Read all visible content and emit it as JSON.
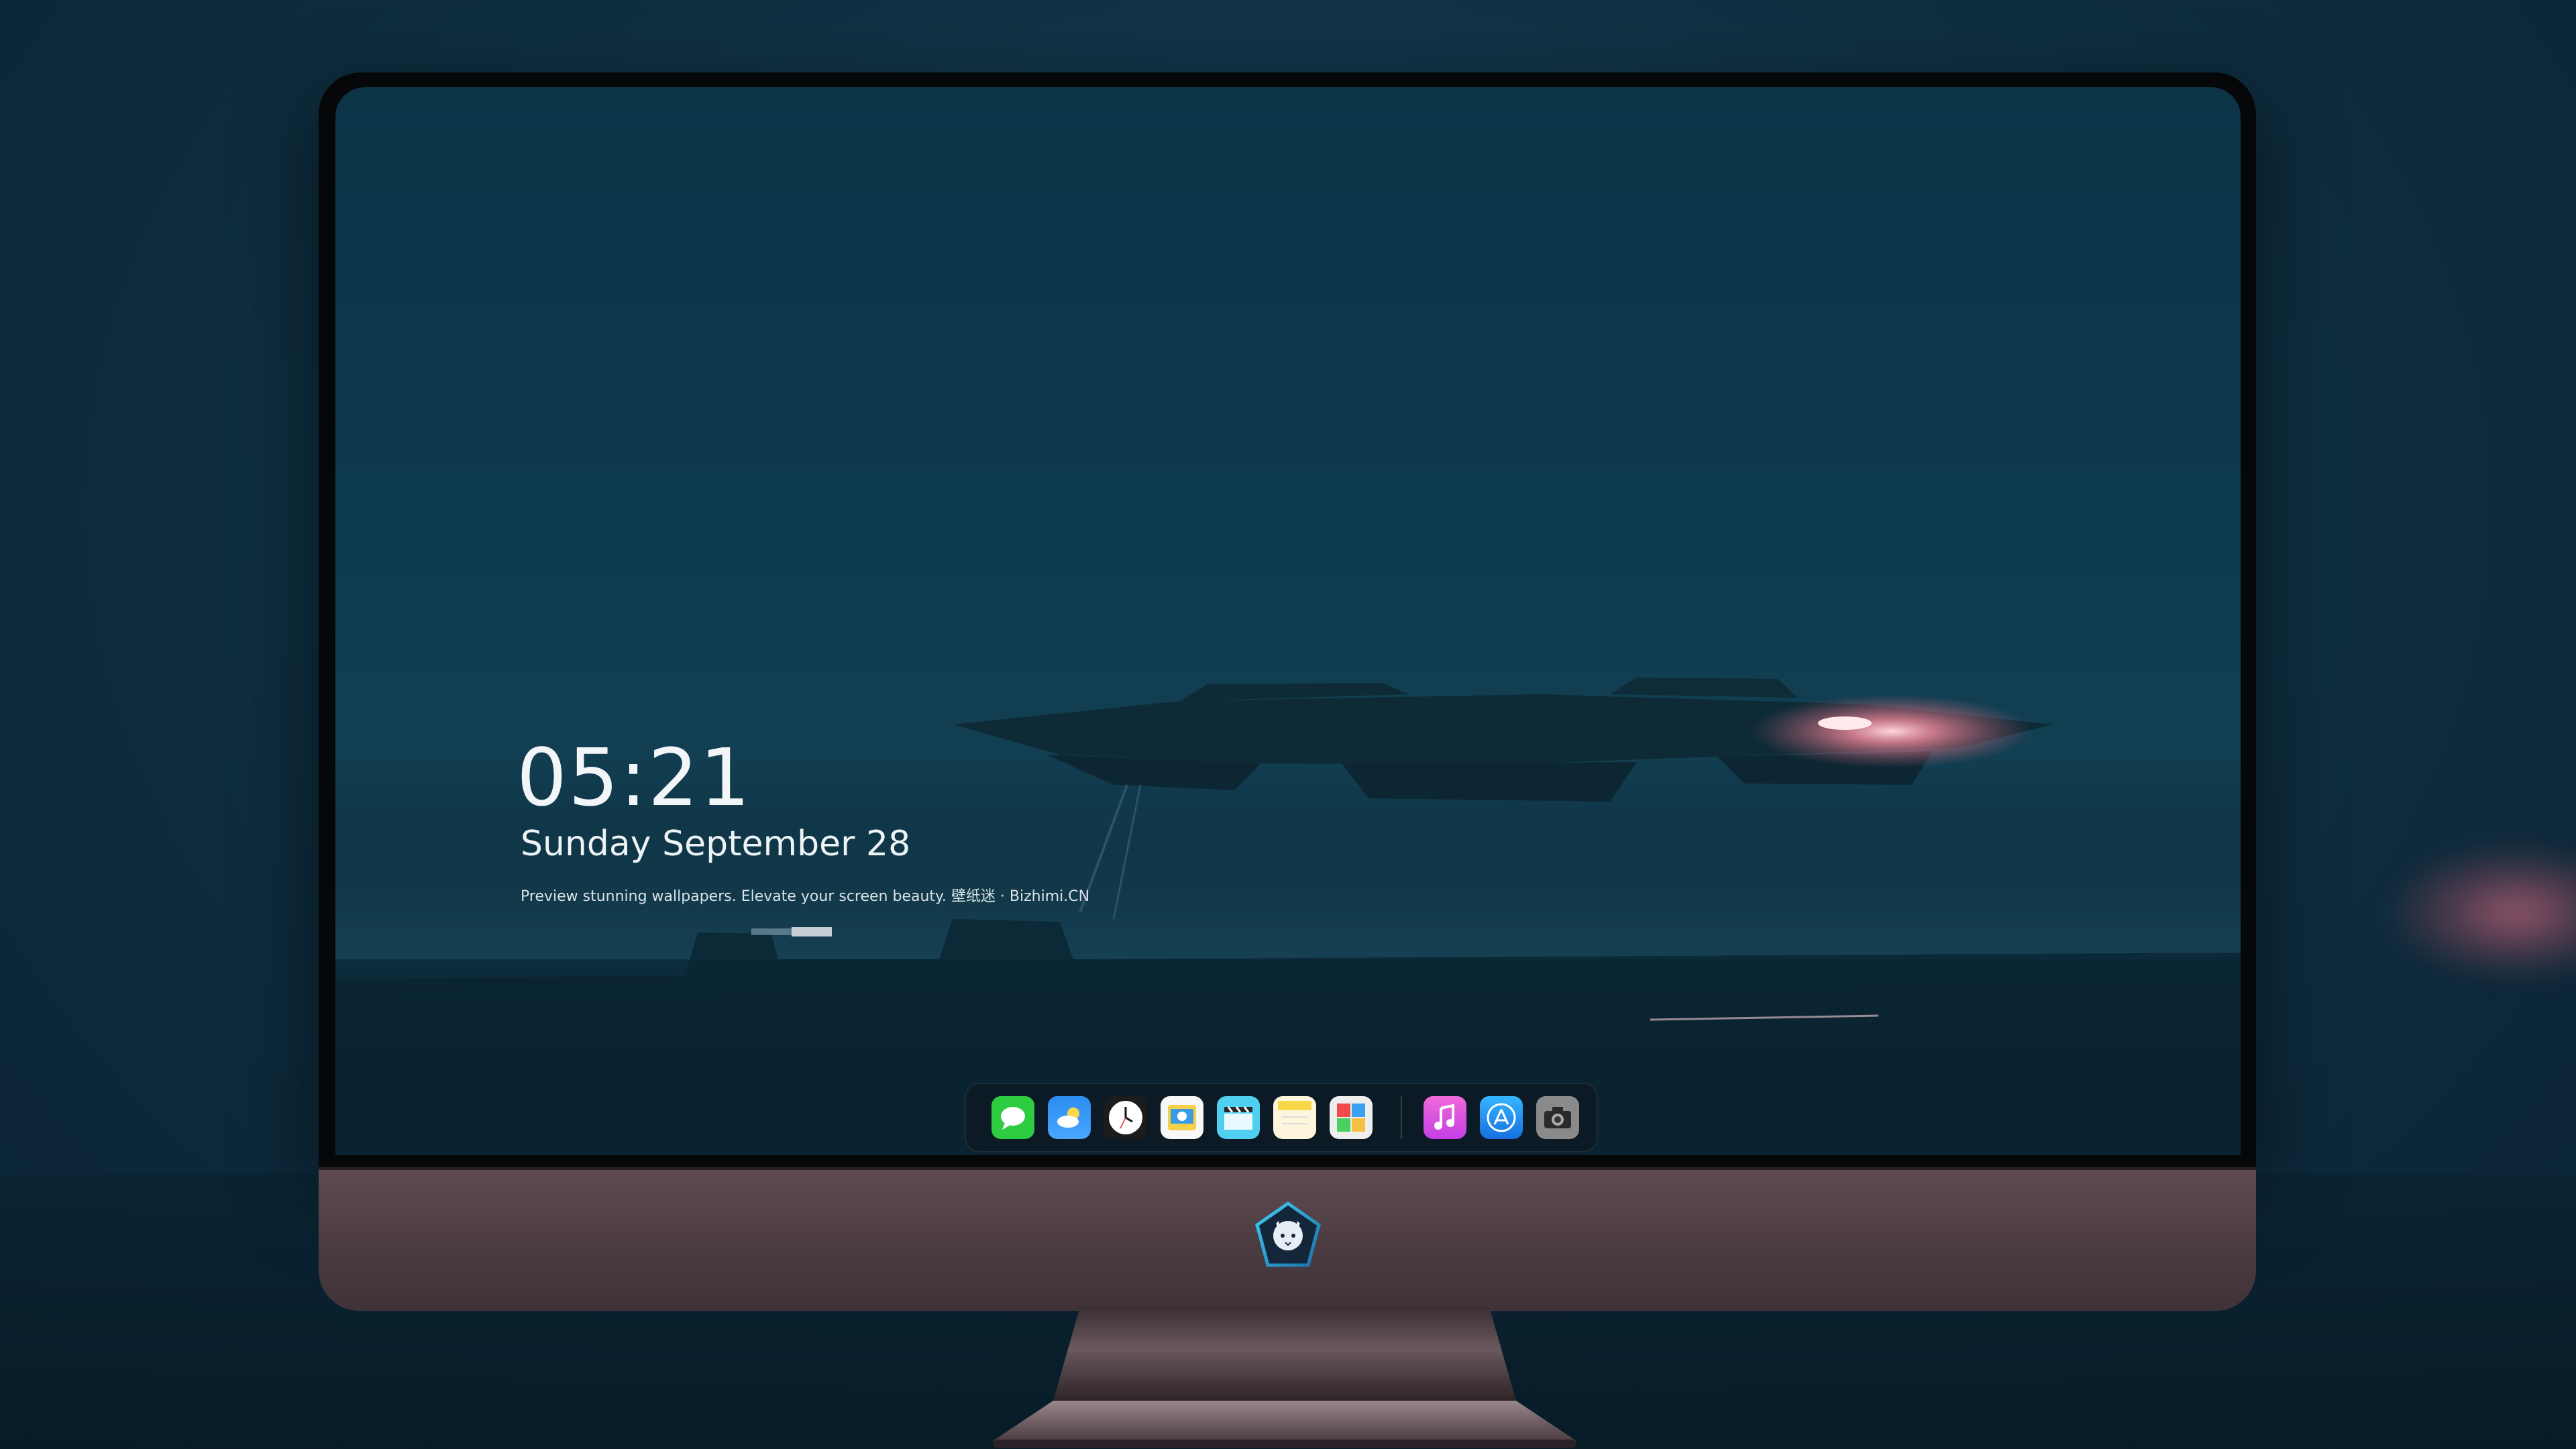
{
  "lockscreen": {
    "time": "05:21",
    "date": "Sunday September  28",
    "tagline": "Preview stunning wallpapers. Elevate your screen beauty. 壁纸迷 · Bizhimi.CN"
  },
  "dock": {
    "apps": [
      {
        "name": "messages",
        "icon": "message-bubble-icon",
        "color": "#2ecc40"
      },
      {
        "name": "weather",
        "icon": "cloud-sun-icon",
        "color": "#2b8df0"
      },
      {
        "name": "clock",
        "icon": "clock-icon",
        "color": "#ffffff"
      },
      {
        "name": "preview",
        "icon": "preview-icon",
        "color": "#f5d04a"
      },
      {
        "name": "clips",
        "icon": "clapperboard-icon",
        "color": "#4fd0f0"
      },
      {
        "name": "notes",
        "icon": "notes-icon",
        "color": "#f9d749"
      },
      {
        "name": "photo-booth",
        "icon": "photo-grid-icon",
        "color": "#e8e8e8"
      },
      {
        "name": "music",
        "icon": "music-note-icon",
        "color": "#d94fe6"
      },
      {
        "name": "app-store",
        "icon": "app-store-icon",
        "color": "#1a8cf5"
      },
      {
        "name": "camera",
        "icon": "camera-icon",
        "color": "#8a8a8a"
      }
    ]
  },
  "colors": {
    "screen_top": "#0b3447",
    "chin": "#5e4a4f",
    "accent_glow": "#e07a8c"
  }
}
